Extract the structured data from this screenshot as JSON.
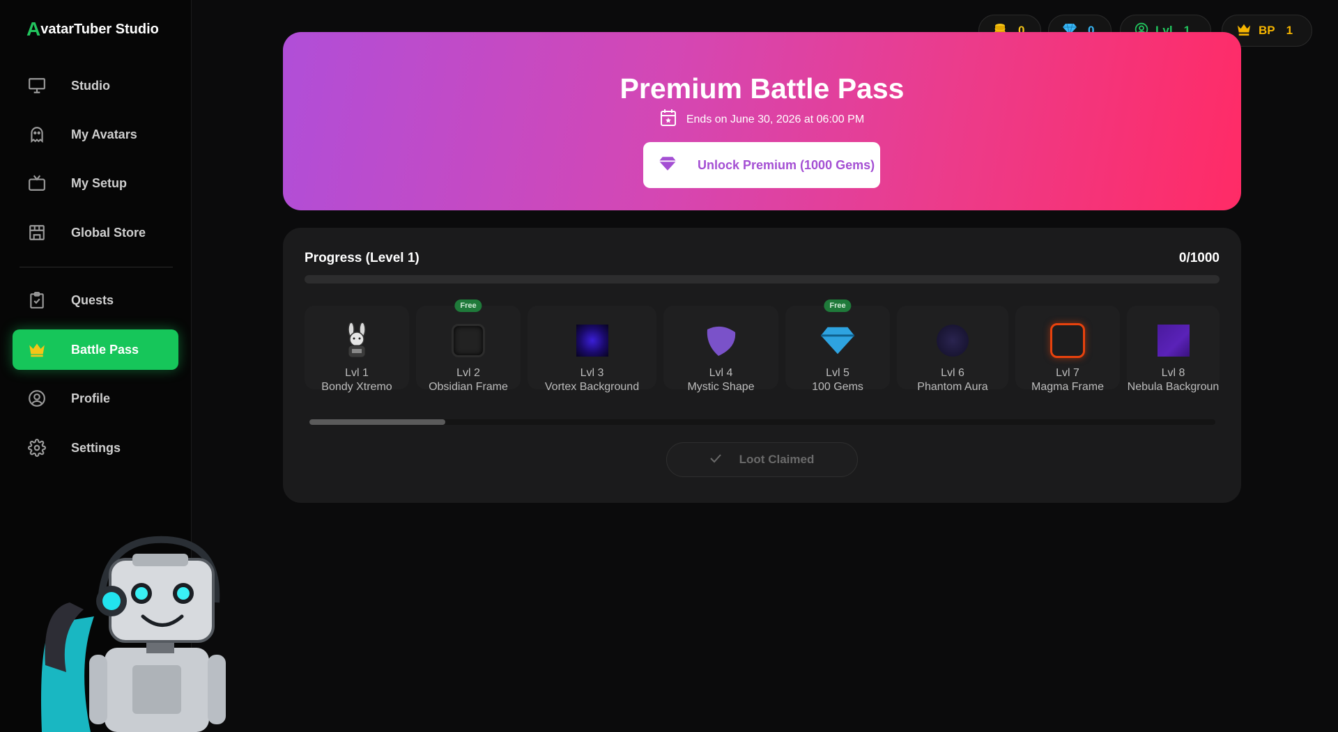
{
  "app": {
    "logo_letter": "A",
    "logo_rest": "vatarTuber Studio",
    "accent": "#16c65a"
  },
  "sidebar": {
    "items": [
      {
        "label": "Studio",
        "icon": "monitor-icon"
      },
      {
        "label": "My Avatars",
        "icon": "ghost-icon"
      },
      {
        "label": "My Setup",
        "icon": "tv-icon"
      },
      {
        "label": "Global Store",
        "icon": "store-icon"
      },
      {
        "label": "Quests",
        "icon": "clipboard-check-icon"
      },
      {
        "label": "Battle Pass",
        "icon": "crown-icon",
        "active": true
      },
      {
        "label": "Profile",
        "icon": "user-circle-icon"
      },
      {
        "label": "Settings",
        "icon": "gear-icon"
      }
    ]
  },
  "stats": {
    "coins": {
      "value": "0",
      "color": "#f5c518"
    },
    "gems": {
      "value": "0",
      "color": "#38b6f5"
    },
    "level": {
      "label": "Lvl",
      "value": "1",
      "color": "#22c55e"
    },
    "bp": {
      "label": "BP",
      "value": "1",
      "color": "#f5b400"
    }
  },
  "hero": {
    "title": "Premium Battle Pass",
    "ends": "Ends on June 30, 2026 at 06:00 PM",
    "unlock_label": "Unlock Premium (1000 Gems)"
  },
  "progress": {
    "title": "Progress (Level 1)",
    "count": "0/1000",
    "fraction": 0,
    "claim_label": "Loot Claimed"
  },
  "rewards": [
    {
      "level": "Lvl 1",
      "name": "Bondy Xtremo",
      "badge": "",
      "icon": "bunny-avatar-icon"
    },
    {
      "level": "Lvl 2",
      "name": "Obsidian Frame",
      "badge": "Free",
      "icon": "obsidian-frame-icon"
    },
    {
      "level": "Lvl 3",
      "name": "Vortex Background",
      "badge": "",
      "icon": "vortex-background-icon"
    },
    {
      "level": "Lvl 4",
      "name": "Mystic Shape",
      "badge": "",
      "icon": "mystic-shape-icon"
    },
    {
      "level": "Lvl 5",
      "name": "100 Gems",
      "badge": "Free",
      "icon": "gem-icon"
    },
    {
      "level": "Lvl 6",
      "name": "Phantom Aura",
      "badge": "",
      "icon": "phantom-aura-icon"
    },
    {
      "level": "Lvl 7",
      "name": "Magma Frame",
      "badge": "",
      "icon": "magma-frame-icon"
    },
    {
      "level": "Lvl 8",
      "name": "Nebula Backgroun",
      "badge": "",
      "icon": "nebula-background-icon"
    }
  ]
}
